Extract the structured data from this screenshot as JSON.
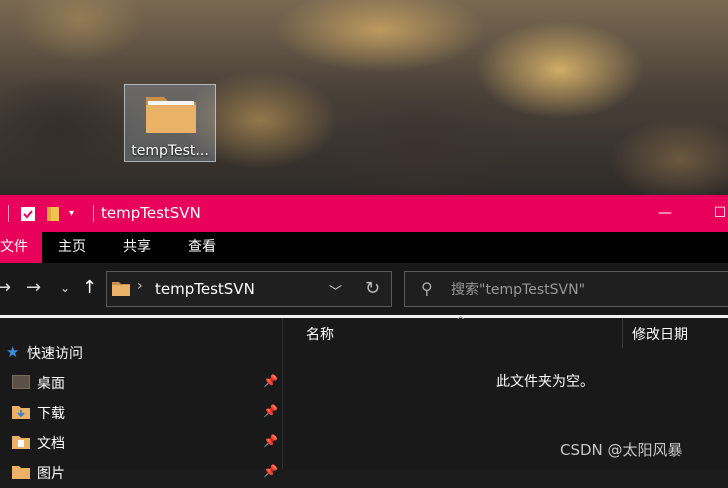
{
  "desktop": {
    "icon_label": "tempTest..."
  },
  "window": {
    "title": "tempTestSVN",
    "accent_color": "#e8005a",
    "qat_icons": [
      "properties-icon",
      "new-folder-icon",
      "qat-dropdown-icon"
    ],
    "controls": [
      "minimize-icon",
      "maximize-icon"
    ]
  },
  "ribbon": {
    "tabs": [
      {
        "label": "文件",
        "active": true
      },
      {
        "label": "主页",
        "active": false
      },
      {
        "label": "共享",
        "active": false
      },
      {
        "label": "查看",
        "active": false
      }
    ]
  },
  "address": {
    "path": "tempTestSVN"
  },
  "search": {
    "placeholder": "搜索\"tempTestSVN\""
  },
  "nav_pane": {
    "items": [
      {
        "label": "快速访问",
        "icon": "star-icon",
        "pinned": false
      },
      {
        "label": "桌面",
        "icon": "desktop-icon",
        "pinned": true
      },
      {
        "label": "下载",
        "icon": "downloads-icon",
        "pinned": true
      },
      {
        "label": "文档",
        "icon": "documents-icon",
        "pinned": true
      },
      {
        "label": "图片",
        "icon": "pictures-icon",
        "pinned": true
      }
    ]
  },
  "columns": {
    "name": "名称",
    "modified": "修改日期"
  },
  "content": {
    "empty_message": "此文件夹为空。"
  },
  "watermark": "CSDN @太阳风暴"
}
